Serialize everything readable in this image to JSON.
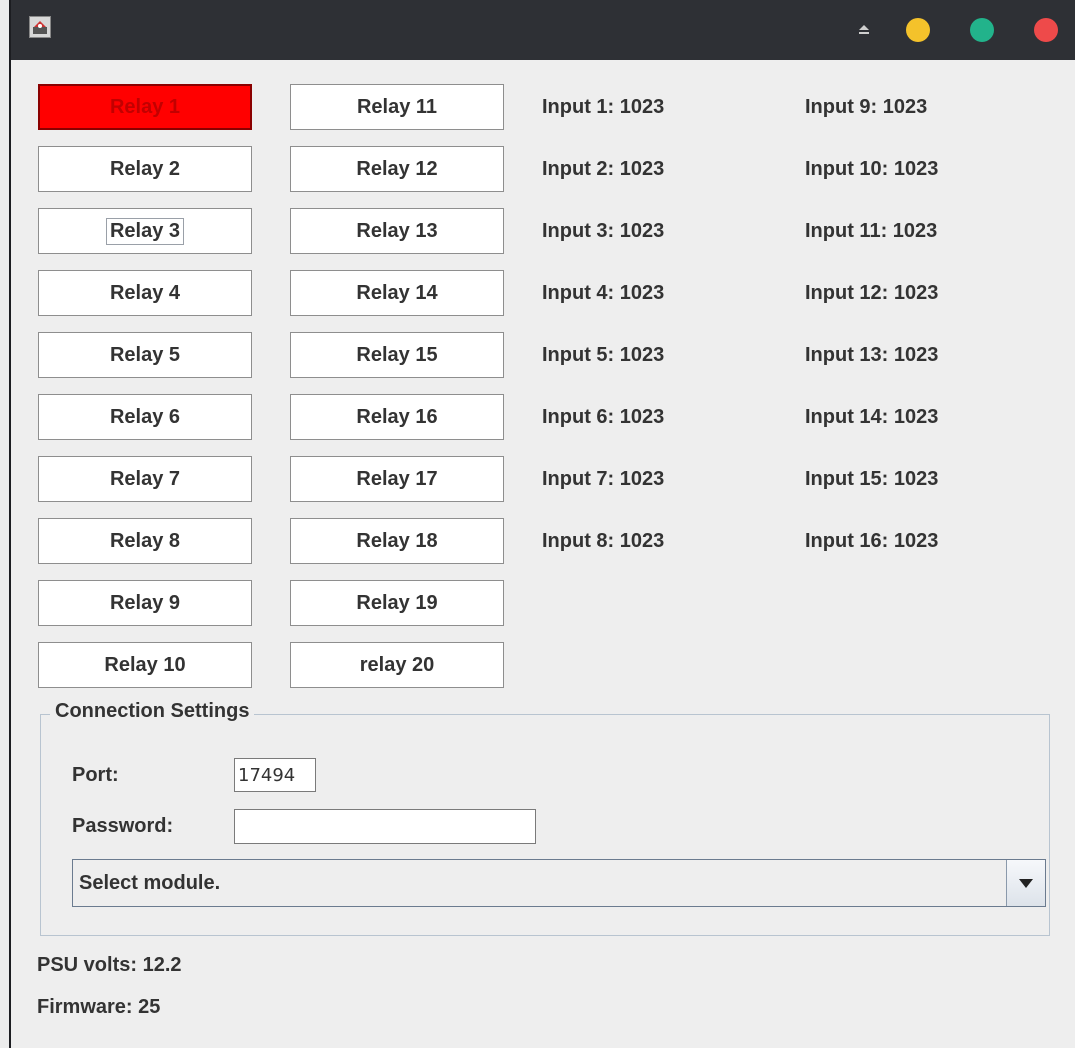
{
  "window": {
    "colors": {
      "titlebar": "#2e3035",
      "minimize": "#f4c22b",
      "maximize": "#22b38b",
      "close": "#ee4a4a",
      "relay_active": "#ff0000"
    }
  },
  "relays": [
    {
      "label": "Relay 1",
      "state": "on"
    },
    {
      "label": "Relay 2",
      "state": "off"
    },
    {
      "label": "Relay 3",
      "state": "off"
    },
    {
      "label": "Relay 4",
      "state": "off"
    },
    {
      "label": "Relay 5",
      "state": "off"
    },
    {
      "label": "Relay 6",
      "state": "off"
    },
    {
      "label": "Relay 7",
      "state": "off"
    },
    {
      "label": "Relay 8",
      "state": "off"
    },
    {
      "label": "Relay 9",
      "state": "off"
    },
    {
      "label": "Relay 10",
      "state": "off"
    },
    {
      "label": "Relay 11",
      "state": "off"
    },
    {
      "label": "Relay 12",
      "state": "off"
    },
    {
      "label": "Relay 13",
      "state": "off"
    },
    {
      "label": "Relay 14",
      "state": "off"
    },
    {
      "label": "Relay 15",
      "state": "off"
    },
    {
      "label": "Relay 16",
      "state": "off"
    },
    {
      "label": "Relay 17",
      "state": "off"
    },
    {
      "label": "Relay 18",
      "state": "off"
    },
    {
      "label": "Relay 19",
      "state": "off"
    },
    {
      "label": "relay 20",
      "state": "off"
    }
  ],
  "inputs": [
    "Input 1: 1023",
    "Input 2: 1023",
    "Input 3: 1023",
    "Input 4: 1023",
    "Input 5: 1023",
    "Input 6: 1023",
    "Input 7: 1023",
    "Input 8: 1023",
    "Input 9: 1023",
    "Input 10: 1023",
    "Input 11: 1023",
    "Input 12: 1023",
    "Input 13: 1023",
    "Input 14: 1023",
    "Input 15: 1023",
    "Input 16: 1023"
  ],
  "connection": {
    "title": "Connection Settings",
    "port_label": "Port:",
    "port_value": "17494",
    "password_label": "Password:",
    "password_value": "",
    "module_select": "Select module."
  },
  "status": {
    "psu": "PSU volts: 12.2",
    "firmware": "Firmware: 25"
  }
}
